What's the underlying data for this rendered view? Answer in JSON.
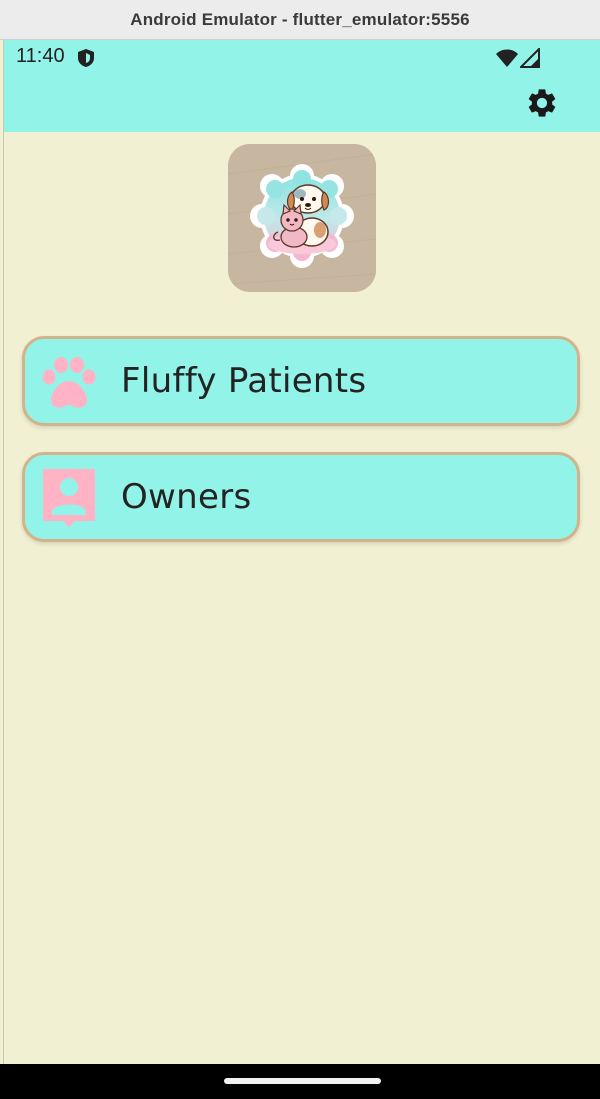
{
  "window": {
    "title": "Android Emulator - flutter_emulator:5556"
  },
  "status_bar": {
    "time": "11:40",
    "icons": [
      "shield-icon",
      "wifi-icon",
      "signal-icon"
    ]
  },
  "app_bar": {
    "actions": [
      "settings-gear-icon"
    ]
  },
  "logo": {
    "description_icon": "puppy-kitten-logo"
  },
  "menu": [
    {
      "label": "Fluffy Patients",
      "icon": "paw-icon"
    },
    {
      "label": "Owners",
      "icon": "person-icon"
    }
  ],
  "colors": {
    "app_bar": "#92f4e9",
    "background": "#f2f0d2",
    "card": "#92f4e9",
    "card_border": "#d2b48c",
    "icon_pink": "#ffb3c4"
  }
}
